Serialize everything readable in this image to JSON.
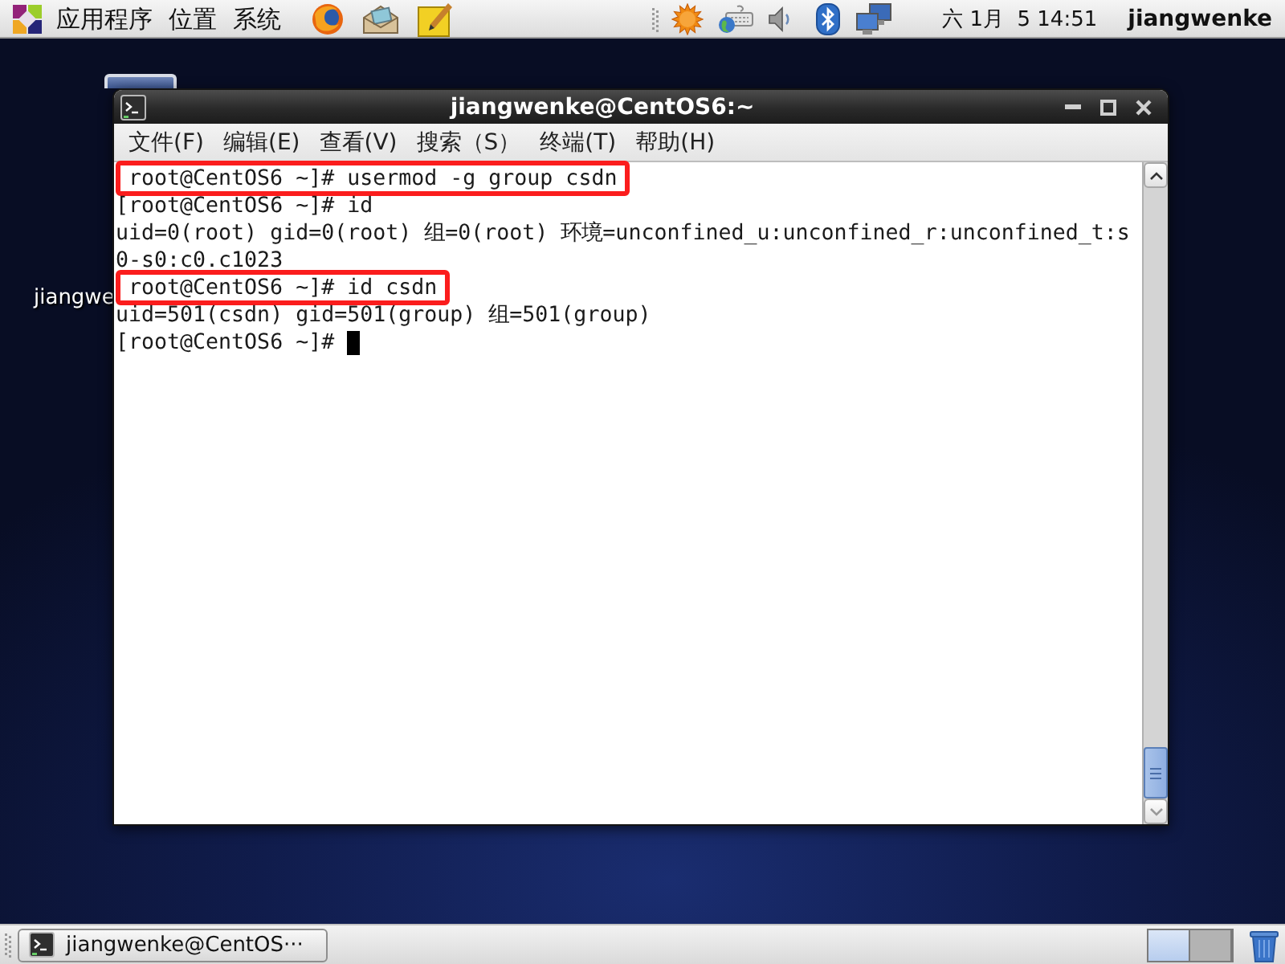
{
  "top_panel": {
    "menus": [
      "应用程序",
      "位置",
      "系统"
    ],
    "clock": "六 1月  5 14:51",
    "user": "jiangwenke"
  },
  "desktop_icons": [
    {
      "label": "jiangwe"
    }
  ],
  "window": {
    "title": "jiangwenke@CentOS6:~",
    "menu": [
      "文件(F)",
      "编辑(E)",
      "查看(V)",
      "搜索（S）",
      "终端(T)",
      "帮助(H)"
    ]
  },
  "terminal": {
    "lines": [
      {
        "text": "root@CentOS6 ~]# usermod -g group csdn",
        "highlighted": true,
        "cursor": false
      },
      {
        "text": "[root@CentOS6 ~]# id",
        "highlighted": false,
        "cursor": false
      },
      {
        "text": "uid=0(root) gid=0(root) 组=0(root) 环境=unconfined_u:unconfined_r:unconfined_t:s",
        "highlighted": false,
        "cursor": false
      },
      {
        "text": "0-s0:c0.c1023",
        "highlighted": false,
        "cursor": false
      },
      {
        "text": "root@CentOS6 ~]# id csdn",
        "highlighted": true,
        "cursor": false
      },
      {
        "text": "uid=501(csdn) gid=501(group) 组=501(group)",
        "highlighted": false,
        "cursor": false
      },
      {
        "text": "[root@CentOS6 ~]#",
        "highlighted": false,
        "cursor": true
      }
    ]
  },
  "taskbar": {
    "tasks": [
      {
        "label": "jiangwenke@CentOS···"
      }
    ],
    "workspaces": [
      {
        "selected": true
      },
      {
        "selected": false
      }
    ]
  }
}
